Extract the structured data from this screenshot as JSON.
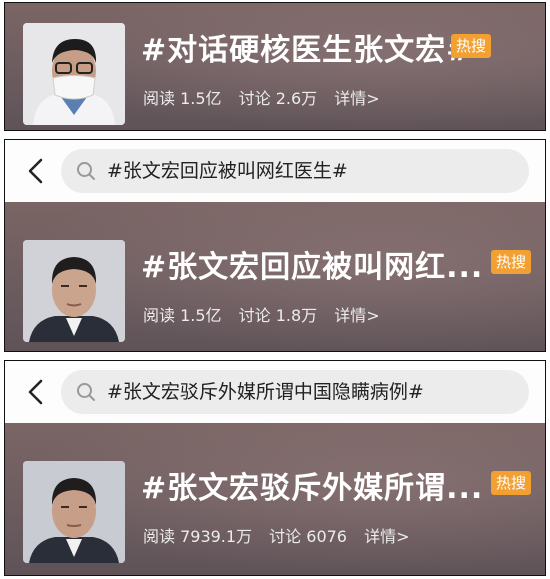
{
  "panels": [
    {
      "search_query": "",
      "title": "#对话硬核医生张文宏#",
      "hot_badge": "热搜",
      "reads": "阅读 1.5亿",
      "discussions": "讨论 2.6万",
      "details": "详情>"
    },
    {
      "search_query": "#张文宏回应被叫网红医生#",
      "title": "#张文宏回应被叫网红...",
      "hot_badge": "热搜",
      "reads": "阅读 1.5亿",
      "discussions": "讨论 1.8万",
      "details": "详情>"
    },
    {
      "search_query": "#张文宏驳斥外媒所谓中国隐瞒病例#",
      "title": "#张文宏驳斥外媒所谓...",
      "hot_badge": "热搜",
      "reads": "阅读 7939.1万",
      "discussions": "讨论 6076",
      "details": "详情>"
    }
  ],
  "colors": {
    "hot_badge": "#f2a032",
    "banner": "#6d5d60",
    "search_pill": "#ececec"
  }
}
